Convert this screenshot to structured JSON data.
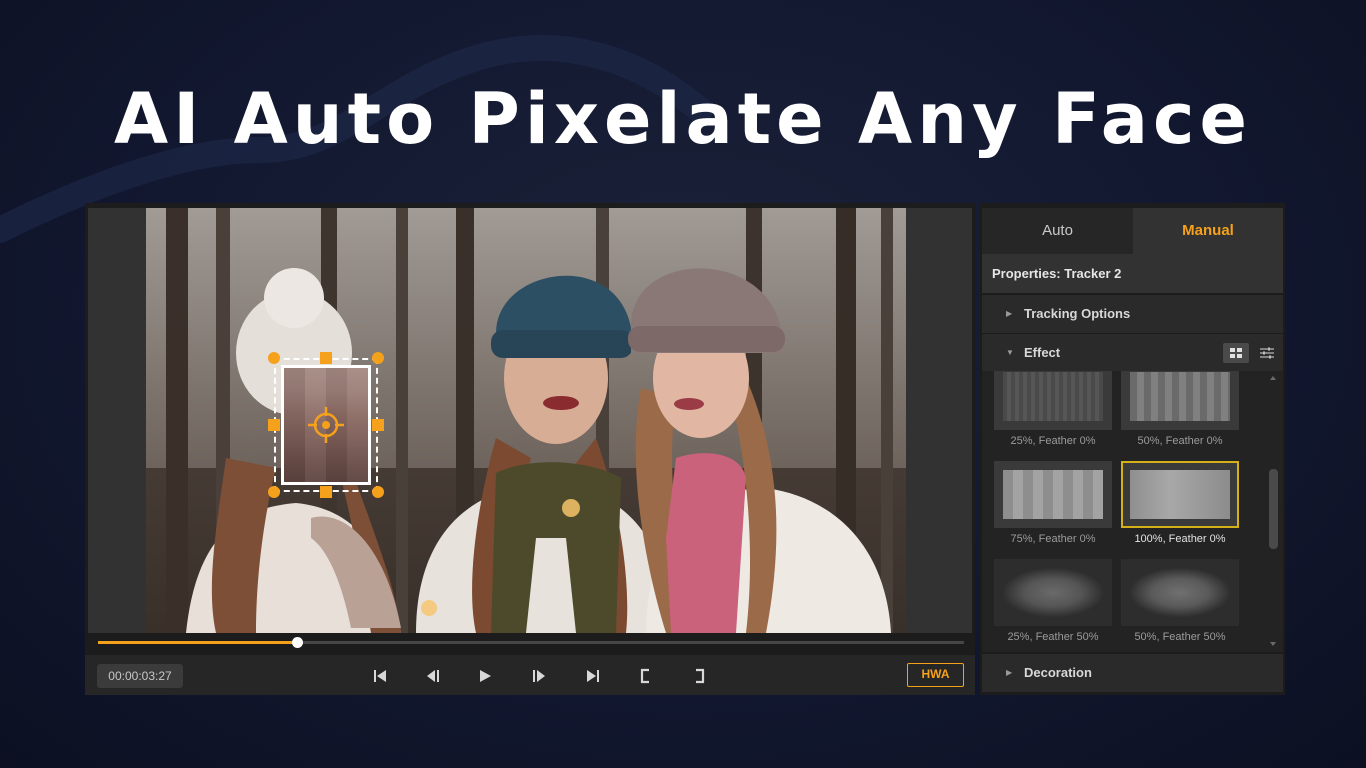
{
  "headline": "AI Auto Pixelate Any Face",
  "player": {
    "timecode": "00:00:03:27",
    "progress": 0.23,
    "hwa_label": "HWA"
  },
  "panel": {
    "tabs": [
      {
        "label": "Auto",
        "active": false
      },
      {
        "label": "Manual",
        "active": true
      }
    ],
    "properties_title": "Properties: Tracker 2",
    "sections": {
      "tracking": "Tracking Options",
      "effect": "Effect",
      "decoration": "Decoration"
    },
    "effects": [
      {
        "label": "25%, Feather 0%",
        "selected": false
      },
      {
        "label": "50%, Feather 0%",
        "selected": false
      },
      {
        "label": "75%, Feather 0%",
        "selected": false
      },
      {
        "label": "100%, Feather 0%",
        "selected": true
      },
      {
        "label": "25%, Feather 50%",
        "selected": false
      },
      {
        "label": "50%, Feather 50%",
        "selected": false
      }
    ]
  },
  "colors": {
    "accent": "#f5a11c",
    "selected_border": "#d6b019",
    "panel_bg": "#1c1c1c"
  }
}
